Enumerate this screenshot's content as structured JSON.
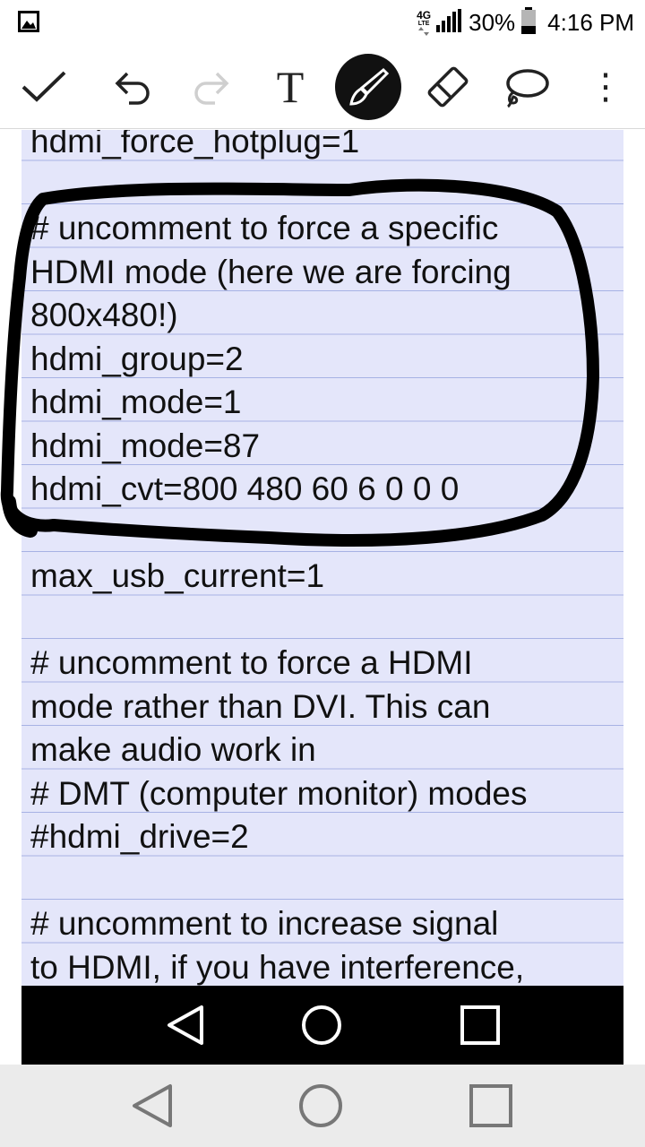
{
  "status_bar": {
    "network": "4G",
    "network_sub": "LTE",
    "battery_percent": "30%",
    "time": "4:16 PM",
    "icons": [
      "gallery-icon",
      "signal-icon",
      "battery-icon"
    ]
  },
  "toolbar": {
    "tools": [
      "check-icon",
      "undo-icon",
      "redo-icon",
      "text-tool-icon",
      "pen-tool-icon",
      "eraser-icon",
      "lasso-icon",
      "more-icon"
    ],
    "text_tool_glyph": "T",
    "more_glyph": "⋮",
    "active_tool": "pen",
    "redo_enabled": false
  },
  "note": {
    "lines": [
      "hdmi_force_hotplug=1",
      "",
      "# uncomment to force a specific",
      "HDMI mode (here we are forcing",
      "800x480!)",
      "hdmi_group=2",
      "hdmi_mode=1",
      "hdmi_mode=87",
      "hdmi_cvt=800 480 60 6 0 0 0",
      "",
      "max_usb_current=1",
      "",
      "# uncomment to force a HDMI",
      "mode rather than DVI. This can",
      "make audio work in",
      "# DMT (computer monitor) modes",
      "#hdmi_drive=2",
      "",
      "# uncomment to increase signal",
      "to HDMI, if you have interference,"
    ],
    "ink_color": "#000000",
    "paper_color": "#e4e6fa",
    "rule_color": "#a7b2e4"
  },
  "nav_bar": {
    "buttons": [
      "back-icon",
      "home-icon",
      "recents-icon"
    ]
  },
  "colors": {
    "active_tool_bg": "#111111",
    "nav_bg": "#000000",
    "system_nav_bg": "#ebebeb"
  }
}
